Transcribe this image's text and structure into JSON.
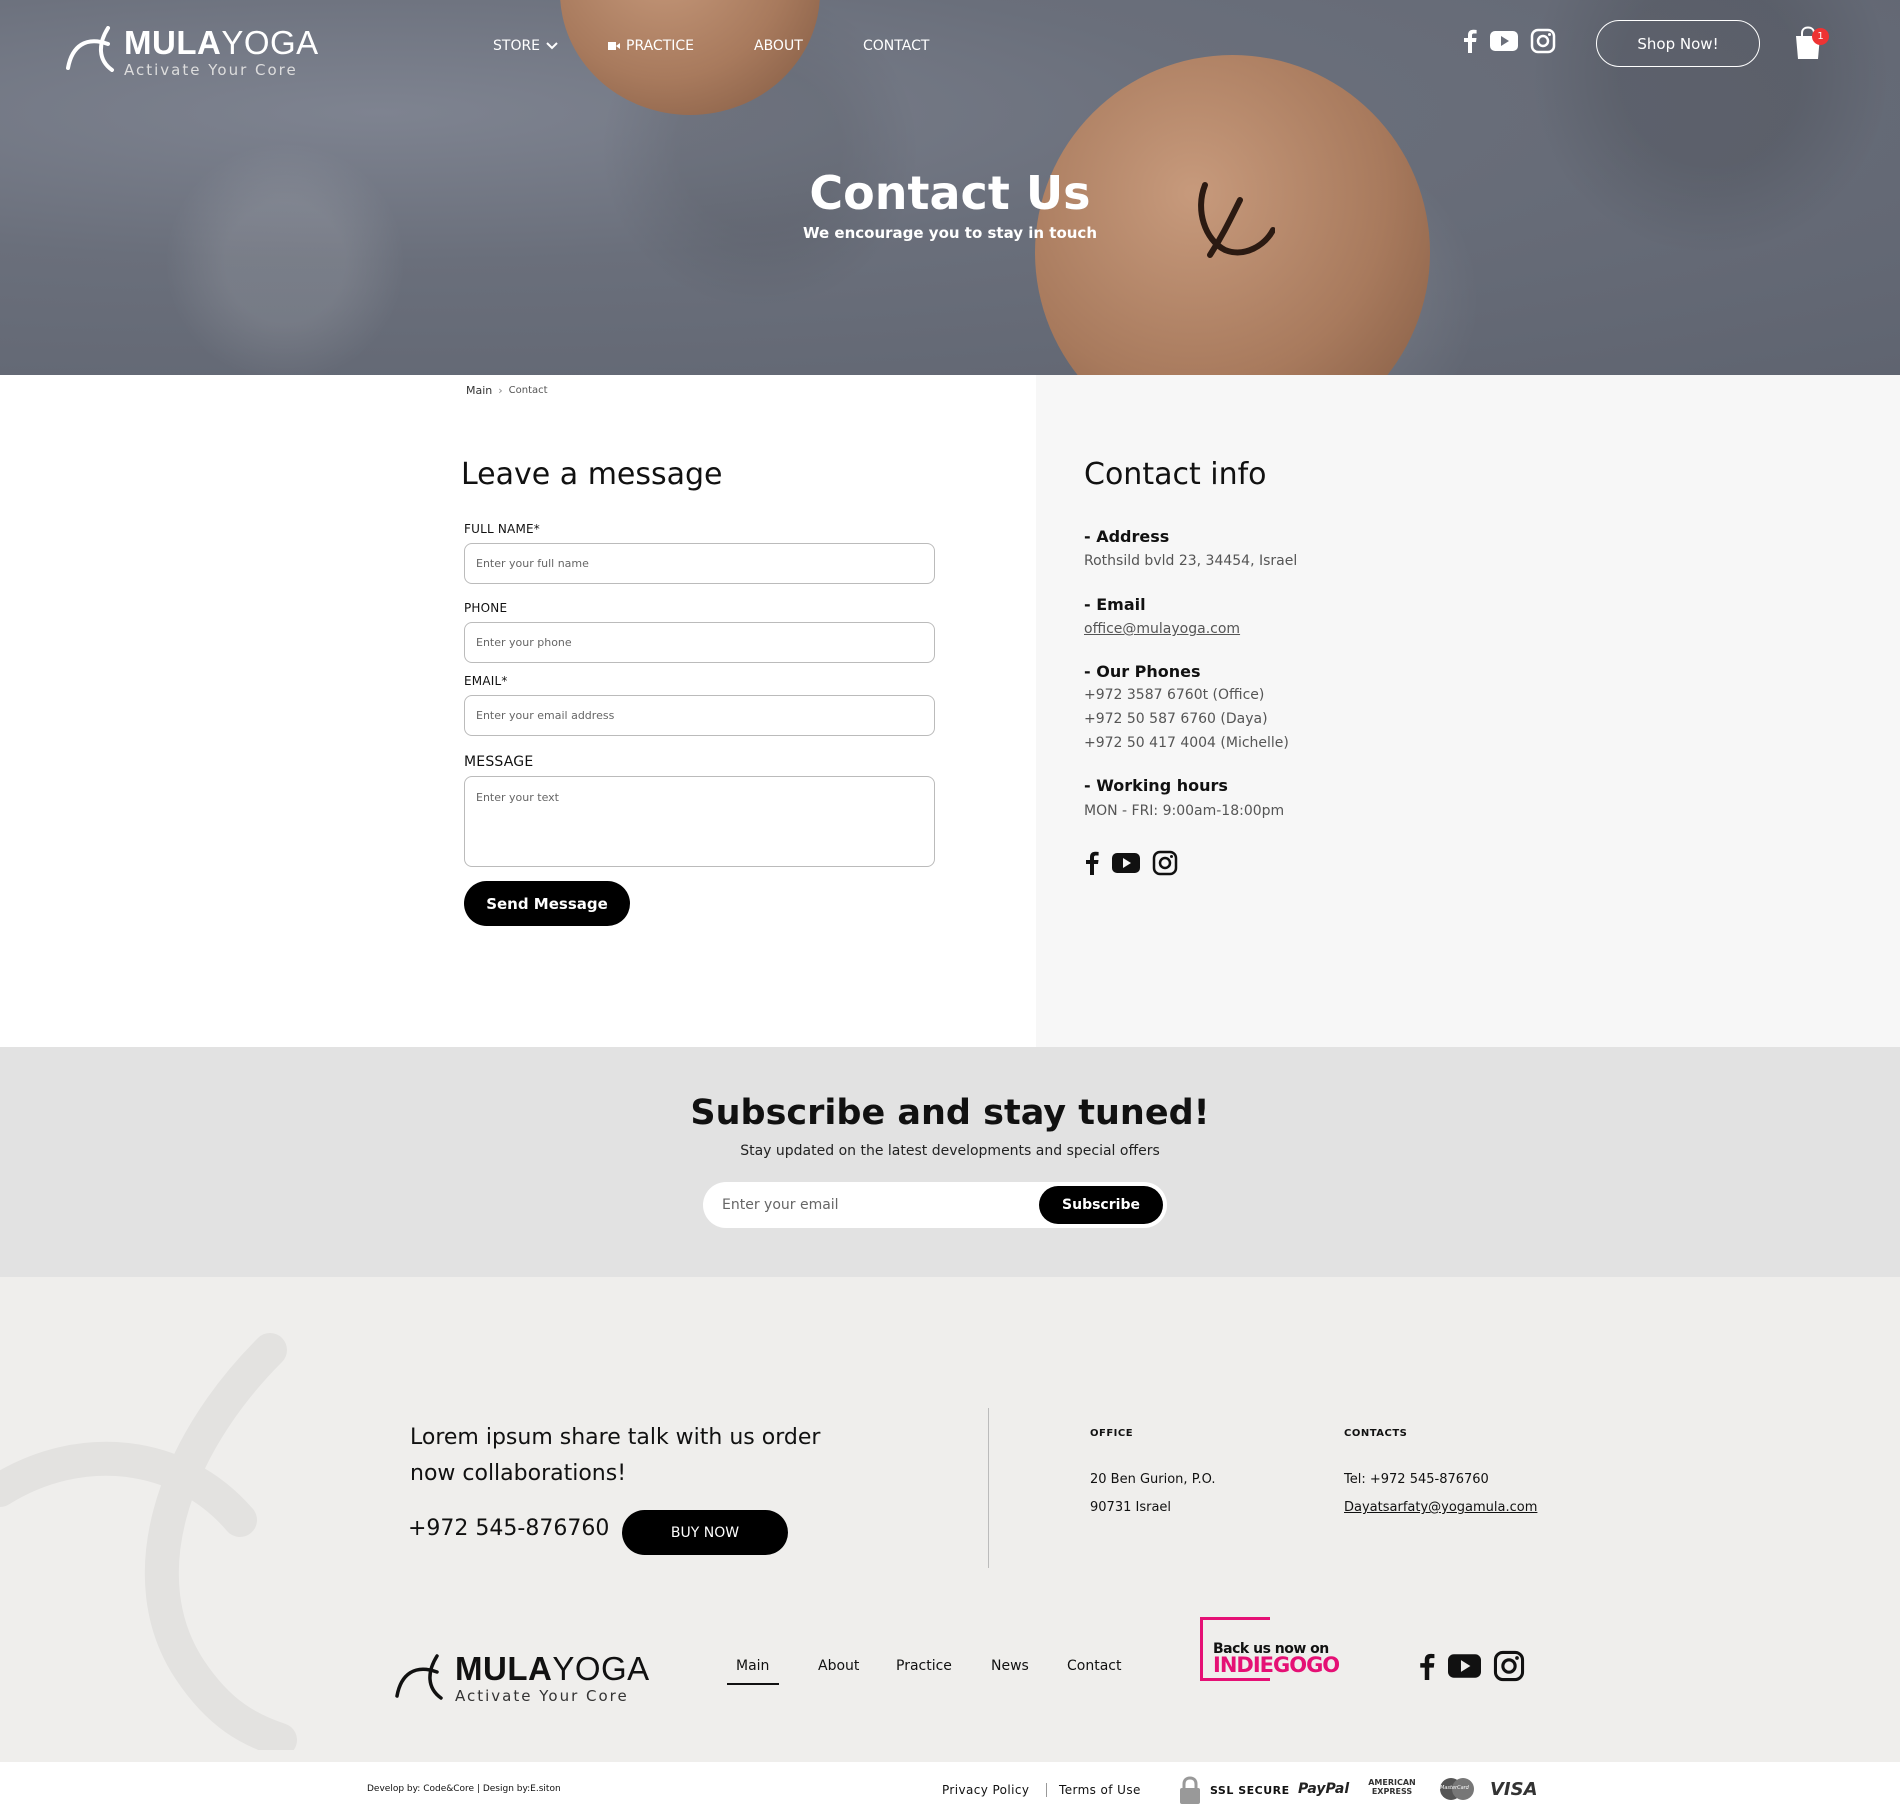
{
  "brand": {
    "name_bold": "MULA",
    "name_light": "YOGA",
    "tagline": "Activate Your Core"
  },
  "nav": {
    "items": [
      {
        "label": "STORE"
      },
      {
        "label": "PRACTICE"
      },
      {
        "label": "ABOUT"
      },
      {
        "label": "CONTACT"
      }
    ],
    "shop_now": "Shop Now!",
    "cart_count": "1"
  },
  "hero": {
    "title": "Contact Us",
    "subtitle": "We encourage you to stay in touch"
  },
  "breadcrumb": {
    "main": "Main",
    "separator": "›",
    "current": "Contact"
  },
  "form": {
    "title": "Leave a message",
    "full_name_label": "FULL NAME*",
    "full_name_placeholder": "Enter your full name",
    "phone_label": "PHONE",
    "phone_placeholder": "Enter your phone",
    "email_label": "EMAIL*",
    "email_placeholder": "Enter your email address",
    "message_label": "MESSAGE",
    "message_placeholder": "Enter your text",
    "submit": "Send Message"
  },
  "contact_info": {
    "title": "Contact info",
    "address_head": "- Address",
    "address": "Rothsild bvld 23, 34454, Israel",
    "email_head": "- Email",
    "email": "office@mulayoga.com",
    "phones_head": "- Our Phones",
    "phones": [
      "+972 3587 6760t (Office)",
      "+972 50 587 6760 (Daya)",
      "+972 50 417 4004 (Michelle)"
    ],
    "hours_head": "- Working hours",
    "hours": "MON - FRI: 9:00am-18:00pm"
  },
  "subscribe": {
    "title": "Subscribe and stay tuned!",
    "subtitle": "Stay updated on the latest developments and special offers",
    "placeholder": "Enter your email",
    "button": "Subscribe"
  },
  "footer": {
    "lead": "Lorem ipsum share talk with us order now collaborations!",
    "phone": "+972 545-876760",
    "buy": "BUY NOW",
    "office_head": "OFFICE",
    "office_line1": "20 Ben Gurion, P.O.",
    "office_line2": "90731 Israel",
    "contacts_head": "CONTACTS",
    "contacts_tel": "Tel: +972 545-876760",
    "contacts_email": "Dayatsarfaty@yogamula.com",
    "nav": [
      "Main",
      "About",
      "Practice",
      "News",
      "Contact"
    ],
    "indiegogo_line1": "Back us now on",
    "indiegogo_line2": "INDIEGOGO",
    "credit": "Develop by: Code&Core | Design by:E.siton",
    "privacy": "Privacy Policy",
    "terms": "Terms of Use",
    "ssl": "SSL SECURE",
    "paypal": "PayPal",
    "amex": "AMERICAN EXPRESS",
    "mastercard": "MasterCard",
    "visa": "VISA"
  }
}
